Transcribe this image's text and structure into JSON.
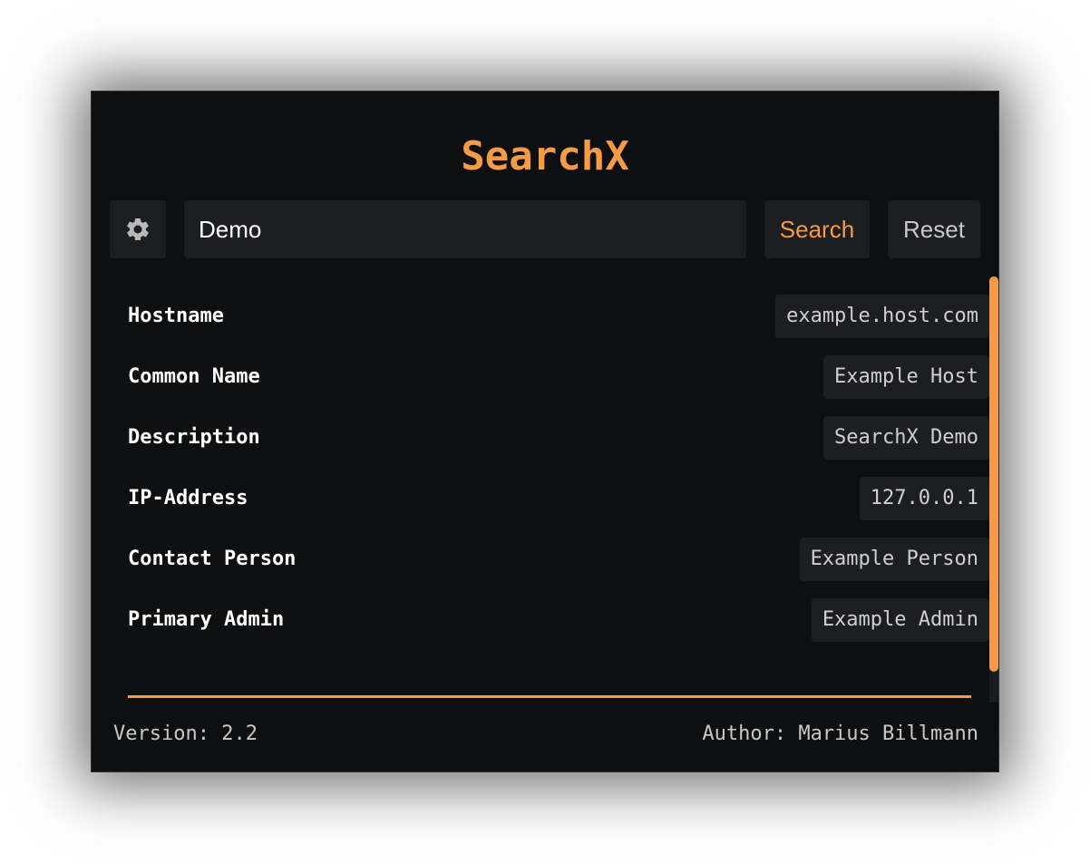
{
  "app": {
    "title": "SearchX"
  },
  "toolbar": {
    "settings_icon": "gear-icon",
    "search_value": "Demo",
    "search_label": "Search",
    "reset_label": "Reset"
  },
  "results": [
    {
      "label": "Hostname",
      "value": "example.host.com"
    },
    {
      "label": "Common Name",
      "value": "Example Host"
    },
    {
      "label": "Description",
      "value": "SearchX Demo"
    },
    {
      "label": "IP-Address",
      "value": "127.0.0.1"
    },
    {
      "label": "Contact Person",
      "value": "Example Person"
    },
    {
      "label": "Primary Admin",
      "value": "Example Admin"
    }
  ],
  "footer": {
    "version": "Version: 2.2",
    "author": "Author: Marius Billmann"
  },
  "colors": {
    "accent": "#f59b46",
    "background": "#0e0f11",
    "surface": "#1c1e21"
  }
}
